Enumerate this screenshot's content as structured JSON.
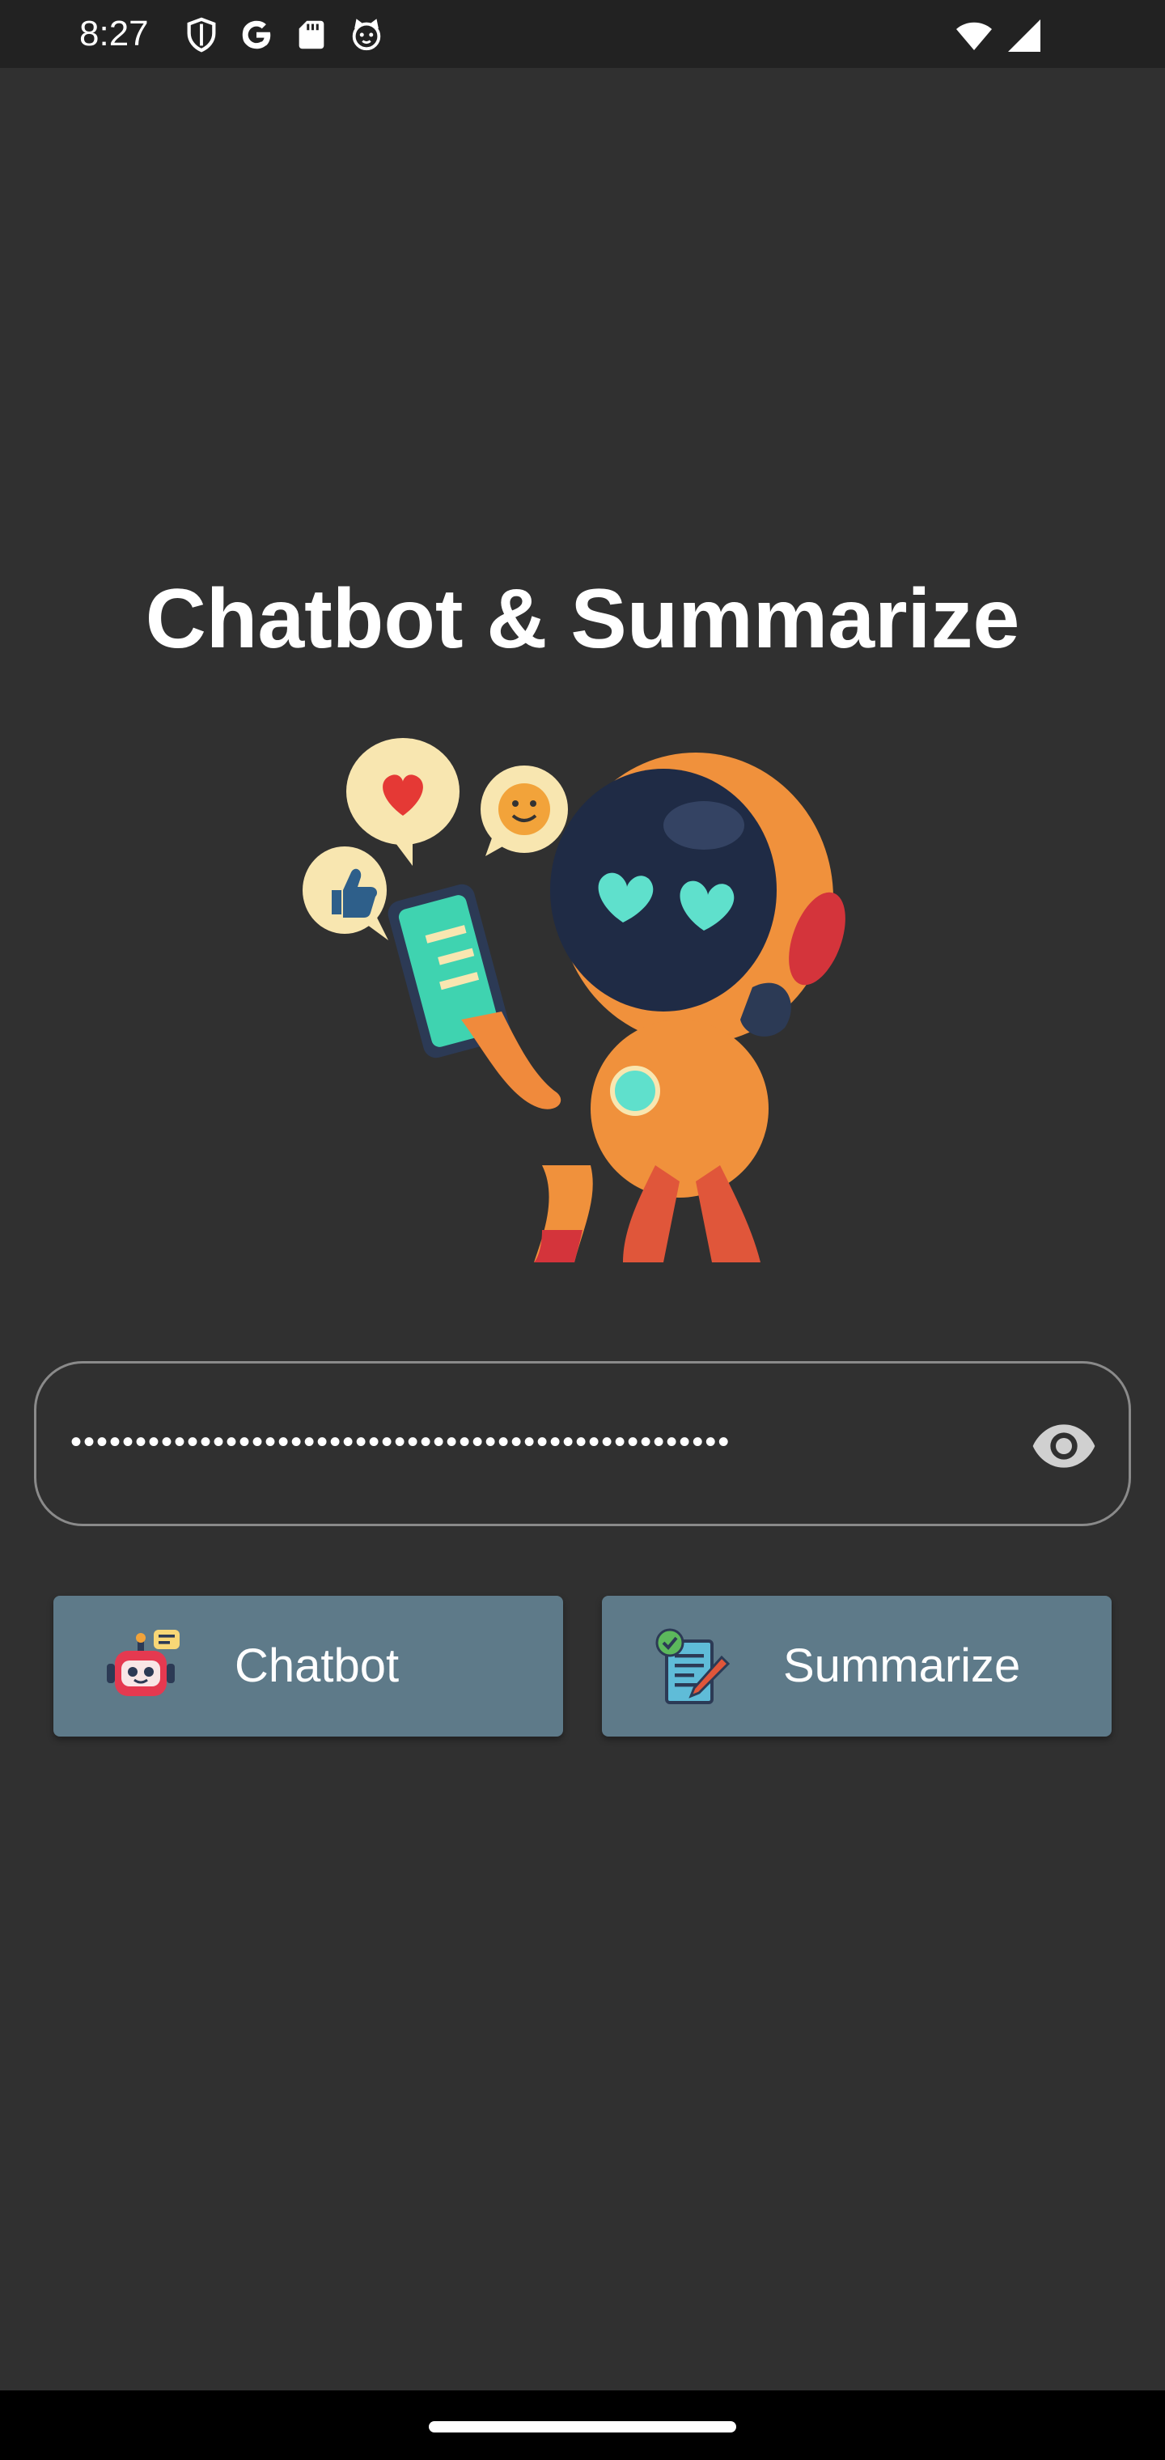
{
  "status_bar": {
    "time": "8:27",
    "icons_left": [
      "shield-icon",
      "google-icon",
      "sd-card-icon",
      "cat-icon"
    ],
    "icons_right": [
      "wifi-icon",
      "signal-icon"
    ]
  },
  "title": "Chatbot & Summarize",
  "password_field": {
    "value": "•••••••••••••••••••••••••••••••••••••••••••••••••••",
    "toggle_icon": "eye-icon"
  },
  "buttons": {
    "chatbot_label": "Chatbot",
    "summarize_label": "Summarize"
  },
  "colors": {
    "background": "#303030",
    "status_bar": "#222222",
    "button": "#5e7a89",
    "field_border": "#8a8a8a"
  }
}
